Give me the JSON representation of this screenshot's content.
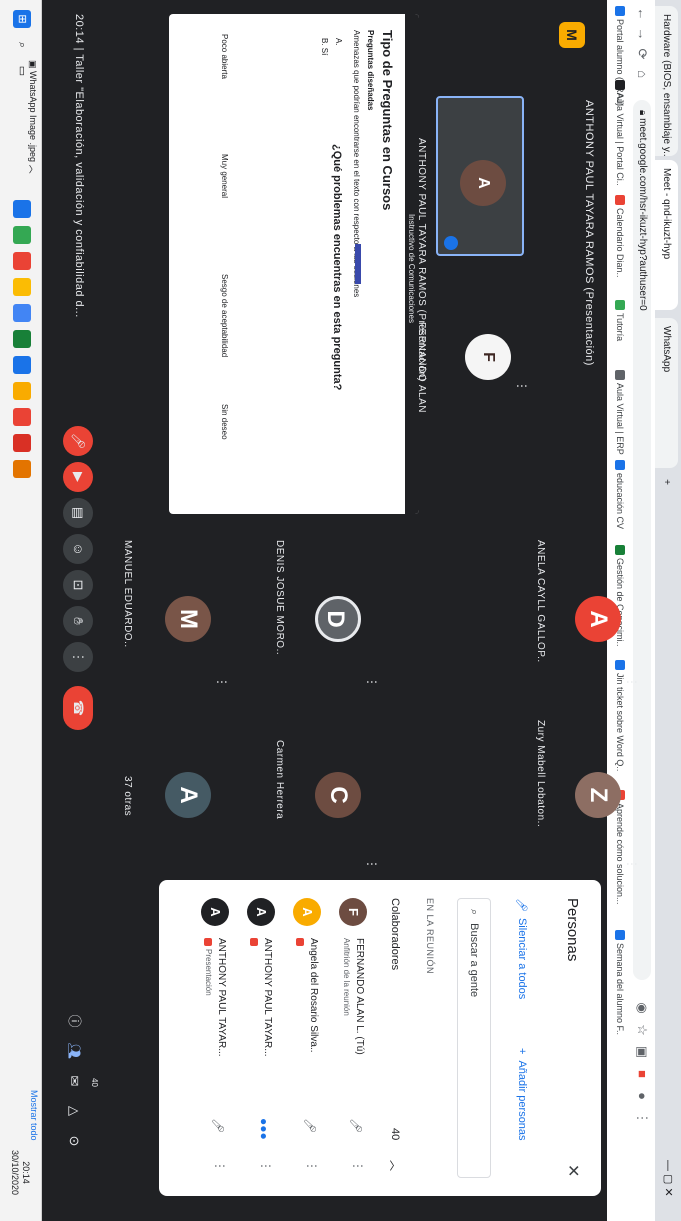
{
  "browser": {
    "tabs": [
      {
        "label": "Hardware (BIOS, ensamblaje y..."
      },
      {
        "label": "Meet - qnd-ikuzt-hyp"
      },
      {
        "label": "WhatsApp"
      }
    ],
    "new_tab": "+",
    "url": "meet.google.com/hsr-ikuzt-hyp?authuser=0",
    "bookmarks": [
      {
        "label": "Portal alumno (PRAJ)",
        "color": "#1a73e8"
      },
      {
        "label": "Aula Virtual | Portal Ci..",
        "color": "#202124"
      },
      {
        "label": "Calendario Dian..",
        "color": "#ea4335"
      },
      {
        "label": "Tutoría",
        "color": "#34a853"
      },
      {
        "label": "Aula Virtual | ERP",
        "color": "#5f6368"
      },
      {
        "label": "educación CV",
        "color": "#1a73e8"
      },
      {
        "label": "Gestión de Conocimi..",
        "color": "#188038"
      },
      {
        "label": "Jin ticket sobre Word Q..",
        "color": "#1a73e8"
      },
      {
        "label": "Aprende cómo solucion...",
        "color": "#ea4335"
      },
      {
        "label": "Semana del alumno F..",
        "color": "#1a73e8"
      }
    ]
  },
  "meet": {
    "presenter_title": "ANTHONY PAUL TAYARA RAMOS (Presentación)",
    "logo": "M",
    "slide": {
      "header": "Instructivo de Comunicaciones",
      "title": "Tipo de Preguntas en Cursos",
      "subtitle": "Preguntas diseñadas",
      "lines": [
        "Amenazas que podrían encontrarse en el texto con respecto a las sesiones",
        "A.",
        "B. Sí"
      ],
      "question": "¿Qué problemas encuentras en esta pregunta?",
      "answers": [
        "Poco abierta",
        "Muy general",
        "Sesgo de aceptabilidad",
        "Sin deseo"
      ]
    },
    "tiles": [
      {
        "name": "ANTHONY PAUL TAYARA RAMOS (Presentación)"
      },
      {
        "name": "FERNANDO ALAN"
      },
      {
        "name": "ANELA CAYLL GALLOP..",
        "initial": "A",
        "color": "#ea4335"
      },
      {
        "name": "Zury Mabell Lobaton..",
        "initial": "Z",
        "color": "#8d6e63"
      },
      {
        "name": "DENIS JOSUE MORO..",
        "initial": "D",
        "color": "#5f6368"
      },
      {
        "name": "Carmen Herrera",
        "initial": "C",
        "color": "#6d4c41"
      },
      {
        "name": "MANUEL EDUARDO..",
        "initial": "M",
        "color": "#795548"
      },
      {
        "name": "37 otras",
        "initial": "A",
        "color": "#455a64"
      }
    ],
    "meeting_code": "20:14 | Taller \"Elaboración, validación y confiabilidad d..."
  },
  "people_panel": {
    "title": "Personas",
    "mute_all": "Silenciar a todos",
    "add_people": "Añadir personas",
    "search_placeholder": "Buscar a gente",
    "section_in_meeting": "EN LA REUNIÓN",
    "collaborators": "Colaboradores",
    "collaborators_count": "40",
    "people": [
      {
        "initial": "F",
        "name": "FERNANDO ALAN L. (Tú)",
        "sub": "Anfitrión de la reunión"
      },
      {
        "initial": "A",
        "name": "Angela del Rosario Silva..",
        "sub": ""
      },
      {
        "initial": "A",
        "name": "ANTHONY PAUL TAYAR...",
        "sub": ""
      },
      {
        "initial": "A",
        "name": "ANTHONY PAUL TAYAR...",
        "sub": "Presentación"
      }
    ]
  },
  "side_count": "40",
  "taskbar": {
    "download": "WhatsApp Image .jpeg",
    "show_all": "Mostrar todo",
    "time": "20:14",
    "date": "30/10/2020"
  }
}
